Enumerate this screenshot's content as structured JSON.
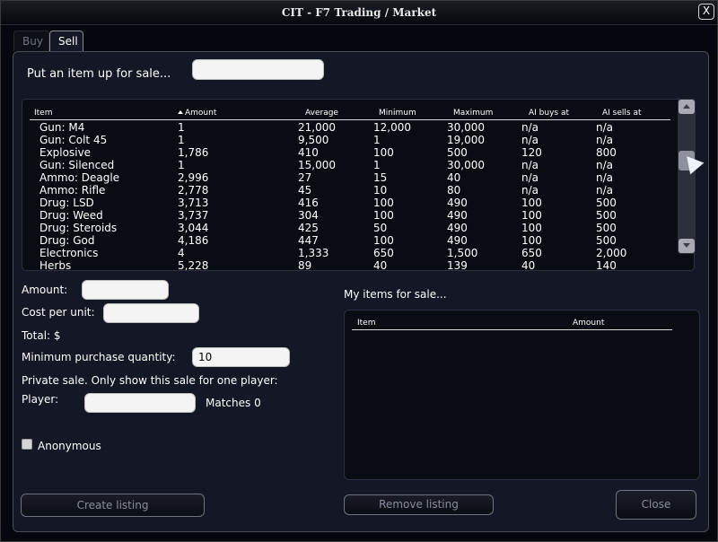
{
  "window": {
    "title": "CIT - F7 Trading / Market",
    "close_label": "X"
  },
  "tabs": [
    {
      "label": "Buy",
      "active": false
    },
    {
      "label": "Sell",
      "active": true
    }
  ],
  "put_up_label": "Put an item up for sale...",
  "put_up_input": {
    "value": "",
    "placeholder": ""
  },
  "market_table": {
    "columns": [
      "Item",
      "Amount",
      "Average",
      "Minimum",
      "Maximum",
      "AI buys at",
      "AI sells at"
    ],
    "sorted_column": "Amount",
    "rows": [
      [
        "Gun: M4",
        "1",
        "21,000",
        "12,000",
        "30,000",
        "n/a",
        "n/a"
      ],
      [
        "Gun: Colt 45",
        "1",
        "9,500",
        "1",
        "19,000",
        "n/a",
        "n/a"
      ],
      [
        "Explosive",
        "1,786",
        "410",
        "100",
        "500",
        "120",
        "800"
      ],
      [
        "Gun: Silenced",
        "1",
        "15,000",
        "1",
        "30,000",
        "n/a",
        "n/a"
      ],
      [
        "Ammo: Deagle",
        "2,996",
        "27",
        "15",
        "40",
        "n/a",
        "n/a"
      ],
      [
        "Ammo: Rifle",
        "2,778",
        "45",
        "10",
        "80",
        "n/a",
        "n/a"
      ],
      [
        "Drug: LSD",
        "3,713",
        "416",
        "100",
        "490",
        "100",
        "500"
      ],
      [
        "Drug: Weed",
        "3,737",
        "304",
        "100",
        "490",
        "100",
        "500"
      ],
      [
        "Drug: Steroids",
        "3,044",
        "425",
        "50",
        "490",
        "100",
        "500"
      ],
      [
        "Drug: God",
        "4,186",
        "447",
        "100",
        "490",
        "100",
        "500"
      ],
      [
        "Electronics",
        "4",
        "1,333",
        "650",
        "1,500",
        "650",
        "2,000"
      ],
      [
        "Herbs",
        "5,228",
        "89",
        "40",
        "139",
        "40",
        "140"
      ]
    ]
  },
  "form": {
    "amount_label": "Amount:",
    "amount_value": "",
    "cost_label": "Cost per unit:",
    "cost_value": "",
    "total_label": "Total: $",
    "min_qty_label": "Minimum purchase quantity:",
    "min_qty_value": "10",
    "private_label": "Private sale. Only show this sale for one player:",
    "player_label": "Player:",
    "player_value": "",
    "matches_label": "Matches 0",
    "anonymous_label": "Anonymous",
    "anonymous_checked": false
  },
  "my_items": {
    "label": "My items for sale...",
    "columns": [
      "Item",
      "Amount"
    ],
    "rows": []
  },
  "buttons": {
    "create": "Create listing",
    "remove": "Remove listing",
    "close": "Close"
  }
}
